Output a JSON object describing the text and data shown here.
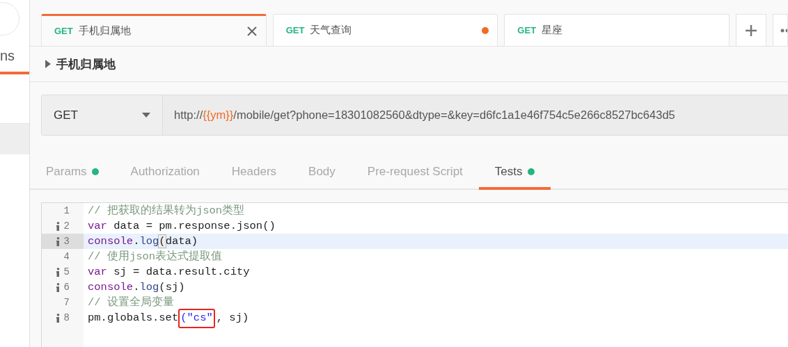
{
  "sidebar": {
    "tab_label": "ns",
    "rows": [
      {
        "selected": false
      },
      {
        "selected": true
      }
    ]
  },
  "request_tabs": [
    {
      "method": "GET",
      "name": "手机归属地",
      "selected": true,
      "unsaved": false
    },
    {
      "method": "GET",
      "name": "天气查询",
      "selected": false,
      "unsaved": true
    },
    {
      "method": "GET",
      "name": "星座",
      "selected": false,
      "unsaved": false
    }
  ],
  "request_title": "手机归属地",
  "request": {
    "method": "GET",
    "url": [
      {
        "kind": "plain",
        "text": "http://"
      },
      {
        "kind": "variable",
        "text": "{{ym}}"
      },
      {
        "kind": "plain",
        "text": "/mobile/get?phone=18301082560&dtype=&key=d6fc1a1e46f754c5e266c8527bc643d5"
      }
    ]
  },
  "section_tabs": [
    {
      "label": "Params",
      "selected": false,
      "has_content": true
    },
    {
      "label": "Authorization",
      "selected": false,
      "has_content": false
    },
    {
      "label": "Headers",
      "selected": false,
      "has_content": false
    },
    {
      "label": "Body",
      "selected": false,
      "has_content": false
    },
    {
      "label": "Pre-request Script",
      "selected": false,
      "has_content": false
    },
    {
      "label": "Tests",
      "selected": true,
      "has_content": true
    }
  ],
  "editor": {
    "lines": [
      {
        "number": "1",
        "info": false,
        "active": false,
        "tokens": [
          {
            "kind": "comment",
            "text": "// 把获取的结果转为json类型"
          }
        ]
      },
      {
        "number": "2",
        "info": true,
        "active": false,
        "tokens": [
          {
            "kind": "keyword",
            "text": "var"
          },
          {
            "kind": "plain",
            "text": " data = pm.response.json()"
          }
        ]
      },
      {
        "number": "3",
        "info": true,
        "active": true,
        "tokens": [
          {
            "kind": "object",
            "text": "console"
          },
          {
            "kind": "plain",
            "text": "."
          },
          {
            "kind": "method",
            "text": "log"
          },
          {
            "kind": "bracket",
            "text": "("
          },
          {
            "kind": "plain",
            "text": "data)"
          }
        ]
      },
      {
        "number": "4",
        "info": false,
        "active": false,
        "tokens": [
          {
            "kind": "comment",
            "text": "// 使用json表达式提取值"
          }
        ]
      },
      {
        "number": "5",
        "info": true,
        "active": false,
        "tokens": [
          {
            "kind": "keyword",
            "text": "var"
          },
          {
            "kind": "plain",
            "text": " sj = data.result.city"
          }
        ]
      },
      {
        "number": "6",
        "info": true,
        "active": false,
        "tokens": [
          {
            "kind": "object",
            "text": "console"
          },
          {
            "kind": "plain",
            "text": "."
          },
          {
            "kind": "method",
            "text": "log"
          },
          {
            "kind": "plain",
            "text": "(sj)"
          }
        ]
      },
      {
        "number": "7",
        "info": false,
        "active": false,
        "tokens": [
          {
            "kind": "comment",
            "text": "// 设置全局变量"
          }
        ]
      },
      {
        "number": "8",
        "info": true,
        "active": false,
        "tokens": [
          {
            "kind": "plain",
            "text": "pm.globals.set"
          },
          {
            "kind": "boxed",
            "text": "(\"cs\""
          },
          {
            "kind": "plain",
            "text": ", sj)"
          }
        ]
      }
    ]
  }
}
